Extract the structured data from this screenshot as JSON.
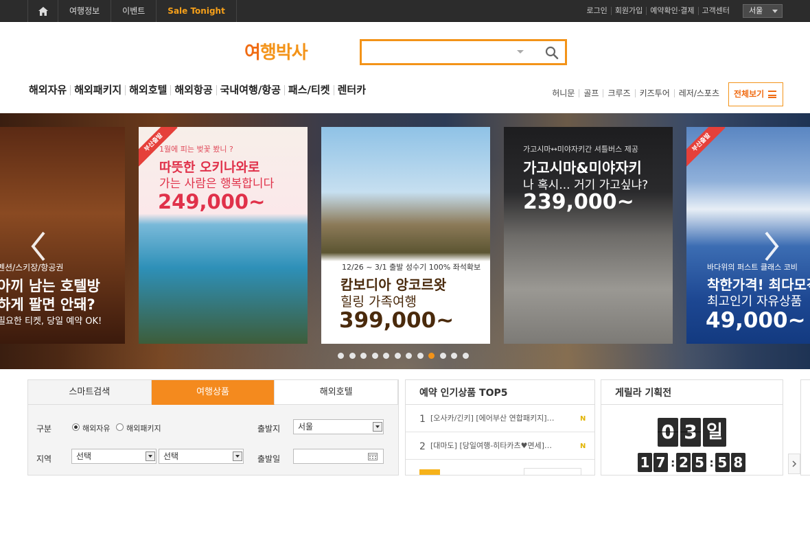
{
  "topbar": {
    "home_icon": "home-icon",
    "items": [
      "여행정보",
      "이벤트",
      "Sale Tonight"
    ],
    "links": [
      "로그인",
      "회원가입",
      "예약확인·결제",
      "고객센터"
    ],
    "city": "서울"
  },
  "logo": {
    "text_first": "여",
    "text_rest": "행박사"
  },
  "search": {
    "value": "",
    "placeholder": ""
  },
  "gnb": [
    "해외자유",
    "해외패키지",
    "해외호텔",
    "해외항공",
    "국내여행/항공",
    "패스/티켓",
    "렌터카"
  ],
  "subnav": [
    "허니문",
    "골프",
    "크루즈",
    "키즈투어",
    "레저/스포츠"
  ],
  "allview": "전체보기",
  "banners": [
    {
      "lines": [
        "펜션/스키장/항공권",
        "아끼 남는 호텔방",
        "하게 팔면 안돼?",
        "필요한 티켓, 당일 예약 OK!"
      ]
    },
    {
      "ribbon": "부산출발",
      "lines": [
        "1월에 피는 벚꽃 봤니 ?",
        "따뜻한 오키나와로",
        "가는 사람은 행복합니다",
        "249,000~"
      ]
    },
    {
      "lines": [
        "12/26 ~ 3/1 출발 성수기 100% 좌석확보",
        "캄보디아 앙코르왓",
        "힐링 가족여행",
        "399,000~"
      ]
    },
    {
      "lines": [
        "가고시마↔미야자키간 셔틀버스 제공",
        "가고시마&미야자키",
        "나 혹시... 거기 가고싶냐?",
        "239,000~"
      ]
    },
    {
      "ribbon": "부산출발",
      "lines": [
        "바다위의 퍼스트 클래스 코비",
        "착한가격! 최다모객!",
        "최고인기 자유상품",
        "49,000~"
      ]
    }
  ],
  "carousel": {
    "total_dots": 12,
    "active_dot": 9
  },
  "search_panel": {
    "tabs": [
      "스마트검색",
      "여행상품",
      "해외호텔"
    ],
    "active_tab": 1,
    "labels": {
      "type": "구분",
      "region": "지역",
      "departure": "출발지",
      "date": "출발일"
    },
    "radios": [
      "해외자유",
      "해외패키지"
    ],
    "region_selects": [
      "선택",
      "선택"
    ],
    "departure_value": "서울",
    "date_value": ""
  },
  "top5": {
    "title": "예약 인기상품 TOP5",
    "items": [
      {
        "rank": "1",
        "text": "[오사카/긴키] [에어부산 연합패키지]…",
        "badge": "N"
      },
      {
        "rank": "2",
        "text": "[대마도] [당일여행-히타카츠♥면세]…",
        "badge": "N"
      }
    ]
  },
  "guerrilla": {
    "title": "게릴라 기획전",
    "days_digits": [
      "0",
      "3"
    ],
    "days_label": "일",
    "time_digits": [
      "1",
      "7",
      "2",
      "5",
      "5",
      "8"
    ]
  },
  "colors": {
    "accent": "#f39318",
    "topbar": "#2c2c2c",
    "tab_active": "#f48a1e"
  }
}
